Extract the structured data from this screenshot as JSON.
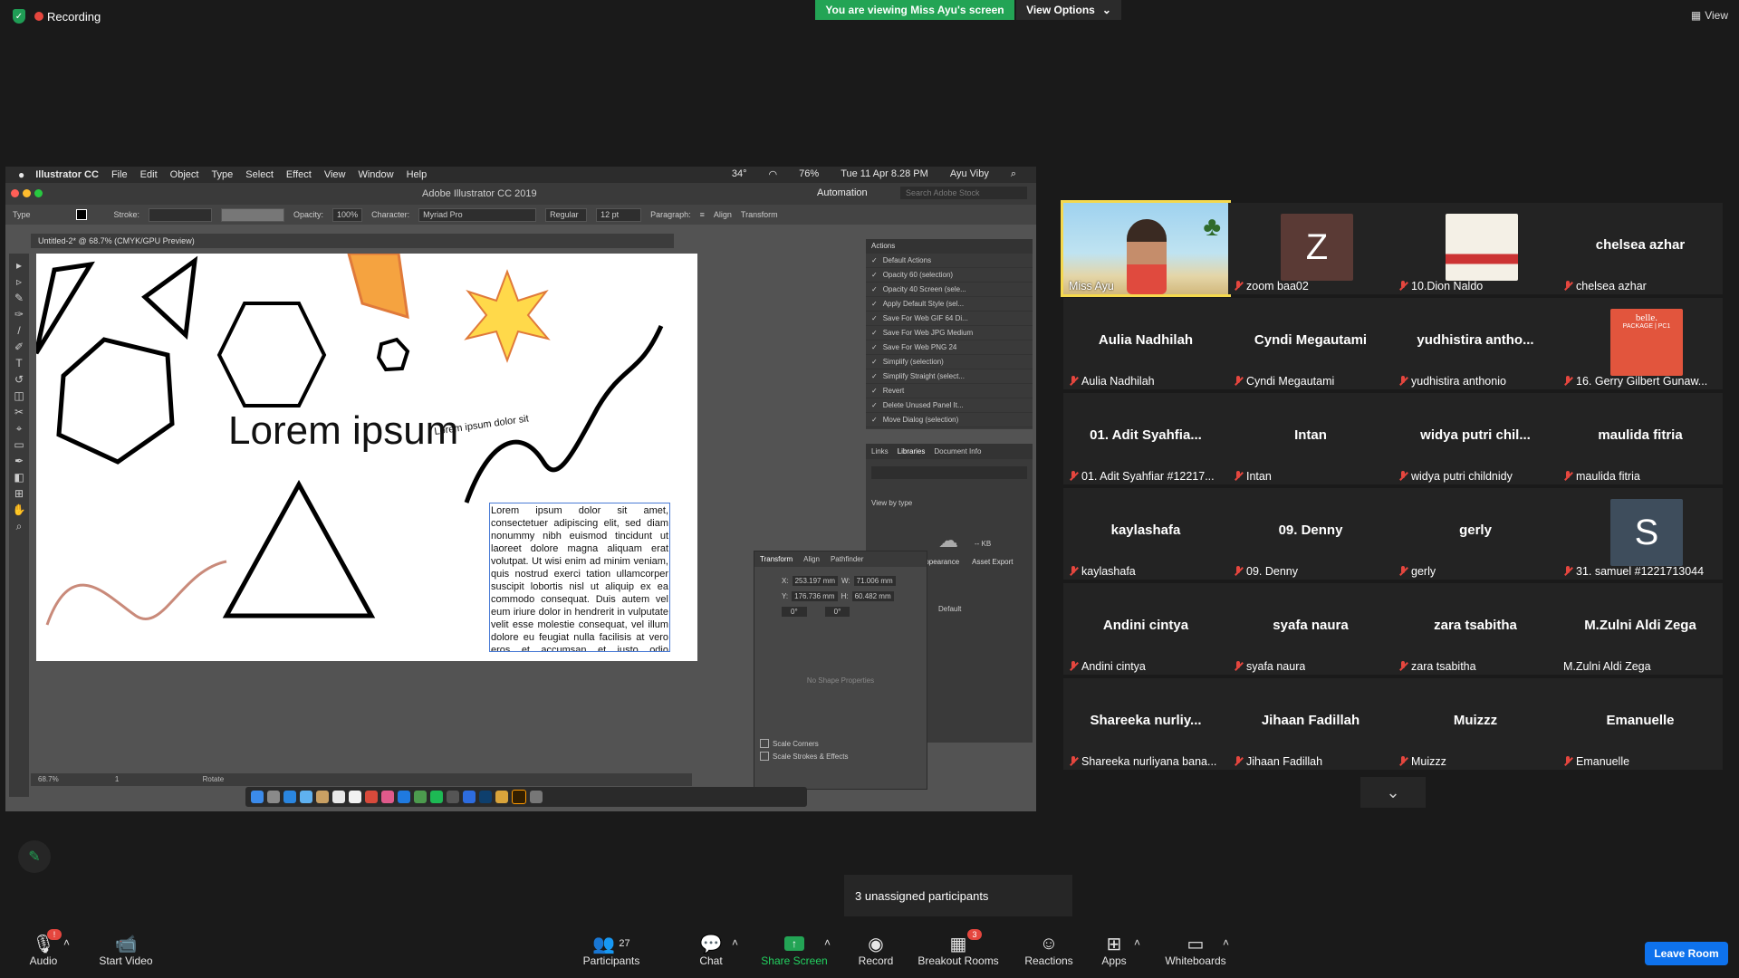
{
  "topbar": {
    "recording_label": "Recording",
    "viewing_banner": "You are viewing Miss Ayu's screen",
    "view_options": "View Options",
    "view_label": "View"
  },
  "shared_screen": {
    "mac_menu": [
      "Illustrator CC",
      "File",
      "Edit",
      "Object",
      "Type",
      "Select",
      "Effect",
      "View",
      "Window",
      "Help"
    ],
    "mac_status": {
      "battery": "76%",
      "datetime": "Tue 11 Apr  8.28 PM",
      "user": "Ayu Viby",
      "temp": "34°"
    },
    "window_title": "Adobe Illustrator CC 2019",
    "workspace": "Automation",
    "search_stock_placeholder": "Search Adobe Stock",
    "control": {
      "tool": "Type",
      "stroke_label": "Stroke:",
      "opacity_label": "Opacity:",
      "opacity_value": "100%",
      "character_label": "Character:",
      "font": "Myriad Pro",
      "style": "Regular",
      "size": "12 pt",
      "paragraph_label": "Paragraph:",
      "align_label": "Align",
      "transform_label": "Transform"
    },
    "doc_tab": "Untitled-2* @ 68.7% (CMYK/GPU Preview)",
    "artboard": {
      "heading": "Lorem ipsum",
      "path_text": "Lorem ipsum dolor sit",
      "area_text": "Lorem ipsum dolor sit amet, consectetuer adipiscing elit, sed diam nonummy nibh euismod tincidunt ut laoreet dolore magna aliquam erat volutpat. Ut wisi enim ad minim veniam, quis nostrud exerci tation ullamcorper suscipit lobortis nisl ut aliquip ex ea commodo consequat. Duis autem vel eum iriure dolor in hendrerit in vulputate velit esse molestie consequat, vel illum dolore eu feugiat nulla facilisis at vero eros et accumsan et iusto odio dignissim qui blandit praesent"
    },
    "actions_panel": {
      "title": "Actions",
      "items": [
        "Default Actions",
        "Opacity 60 (selection)",
        "Opacity 40 Screen (sele...",
        "Apply Default Style (sel...",
        "Save For Web GIF 64 Di...",
        "Save For Web JPG Medium",
        "Save For Web PNG 24",
        "Simplify (selection)",
        "Simplify Straight (select...",
        "Revert",
        "Delete Unused Panel It...",
        "Move Dialog (selection)"
      ]
    },
    "libraries_panel": {
      "tabs": [
        "Links",
        "Libraries",
        "Document Info"
      ],
      "view_by": "View by type",
      "kb": "-- KB"
    },
    "transform_panel": {
      "tabs": [
        "Transform",
        "Align",
        "Pathfinder"
      ],
      "x_label": "X:",
      "x": "253.197 mm",
      "w_label": "W:",
      "w": "71.006 mm",
      "y_label": "Y:",
      "y": "176.736 mm",
      "h_label": "H:",
      "h": "60.482 mm",
      "angle": "0°",
      "shear": "0°",
      "no_shape": "No Shape Properties",
      "scale_corners": "Scale Corners",
      "scale_strokes": "Scale Strokes & Effects"
    },
    "appearance_tabs": [
      "Appearance",
      "Asset Export"
    ],
    "appearance_default": "Default",
    "status": {
      "zoom": "68.7%",
      "page": "1",
      "tool": "Rotate"
    }
  },
  "gallery": {
    "tiles": [
      {
        "center": "",
        "label": "Miss Ayu",
        "muted": false,
        "kind": "video"
      },
      {
        "center": "",
        "label": "zoom baa02",
        "muted": true,
        "kind": "avatar",
        "avatar_letter": "Z",
        "avatar_color": "#5a3a35"
      },
      {
        "center": "",
        "label": "10.Dion Naldo",
        "muted": true,
        "kind": "image"
      },
      {
        "center": "chelsea azhar",
        "label": "chelsea azhar",
        "muted": true,
        "kind": "name"
      },
      {
        "center": "Aulia Nadhilah",
        "label": "Aulia Nadhilah",
        "muted": true,
        "kind": "name"
      },
      {
        "center": "Cyndi Megautami",
        "label": "Cyndi Megautami",
        "muted": true,
        "kind": "name"
      },
      {
        "center": "yudhistira antho...",
        "label": "yudhistira anthonio",
        "muted": true,
        "kind": "name"
      },
      {
        "center": "",
        "label": "16. Gerry Gilbert Gunaw...",
        "muted": true,
        "kind": "image2"
      },
      {
        "center": "01. Adit Syahfia...",
        "label": "01. Adit Syahfiar #12217...",
        "muted": true,
        "kind": "name"
      },
      {
        "center": "Intan",
        "label": "Intan",
        "muted": true,
        "kind": "name"
      },
      {
        "center": "widya putri chil...",
        "label": "widya putri childnidy",
        "muted": true,
        "kind": "name"
      },
      {
        "center": "maulida fitria",
        "label": "maulida fitria",
        "muted": true,
        "kind": "name"
      },
      {
        "center": "kaylashafa",
        "label": "kaylashafa",
        "muted": true,
        "kind": "name"
      },
      {
        "center": "09. Denny",
        "label": "09. Denny",
        "muted": true,
        "kind": "name"
      },
      {
        "center": "gerly",
        "label": "gerly",
        "muted": true,
        "kind": "name"
      },
      {
        "center": "",
        "label": "31. samuel #1221713044",
        "muted": true,
        "kind": "avatar",
        "avatar_letter": "S",
        "avatar_color": "#3e4d5c"
      },
      {
        "center": "Andini cintya",
        "label": "Andini cintya",
        "muted": true,
        "kind": "name"
      },
      {
        "center": "syafa naura",
        "label": "syafa naura",
        "muted": true,
        "kind": "name"
      },
      {
        "center": "zara tsabitha",
        "label": "zara tsabitha",
        "muted": true,
        "kind": "name"
      },
      {
        "center": "M.Zulni Aldi Zega",
        "label": "M.Zulni Aldi Zega",
        "muted": false,
        "kind": "name"
      },
      {
        "center": "Shareeka  nurliy...",
        "label": "Shareeka nurliyana bana...",
        "muted": true,
        "kind": "name"
      },
      {
        "center": "Jihaan Fadillah",
        "label": "Jihaan Fadillah",
        "muted": true,
        "kind": "name"
      },
      {
        "center": "Muizzz",
        "label": "Muizzz",
        "muted": true,
        "kind": "name"
      },
      {
        "center": "Emanuelle",
        "label": "Emanuelle",
        "muted": true,
        "kind": "name"
      }
    ],
    "image_tile_text": "belle.",
    "image_tile_sub": "PACKAGE | PC1"
  },
  "toast": "3 unassigned participants",
  "toolbar": {
    "audio": "Audio",
    "start_video": "Start Video",
    "participants": "Participants",
    "participants_count": "27",
    "chat": "Chat",
    "share_screen": "Share Screen",
    "record": "Record",
    "breakout_rooms": "Breakout Rooms",
    "breakout_badge": "3",
    "reactions": "Reactions",
    "apps": "Apps",
    "whiteboards": "Whiteboards",
    "leave_room": "Leave Room",
    "audio_badge": "!"
  }
}
